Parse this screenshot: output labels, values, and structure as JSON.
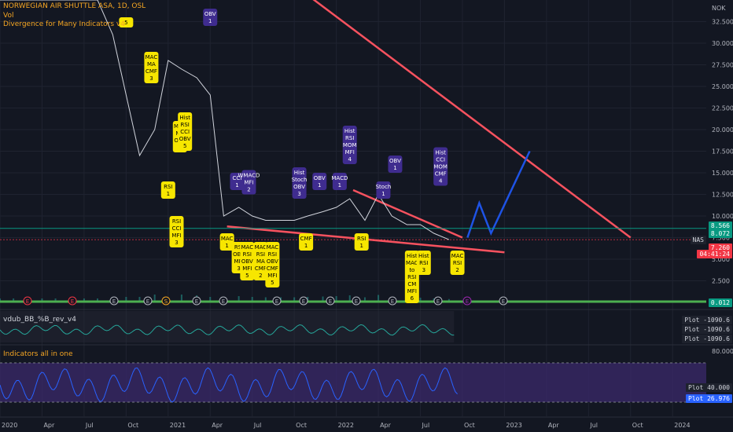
{
  "header": {
    "symbol_line": "NORWEGIAN AIR SHUTTLE ASA, 1D, OSL",
    "vol_label": "Vol",
    "indicator_label": "Divergence for Many Indicators v4",
    "pane2_label": "vdub_BB_%B_rev_v4",
    "pane3_label": "Indicators all in one",
    "currency": "NOK"
  },
  "chart_data": {
    "type": "line",
    "title": "NORWEGIAN AIR SHUTTLE ASA, 1D, OSL",
    "price_axis": {
      "ticks": [
        "32.500",
        "30.000",
        "27.500",
        "25.000",
        "22.500",
        "20.000",
        "17.500",
        "15.000",
        "12.500",
        "10.000",
        "7.500",
        "5.000",
        "2.500"
      ],
      "ylim": [
        0,
        35
      ]
    },
    "x_ticks": [
      "2020",
      "Apr",
      "Jul",
      "Oct",
      "2021",
      "Apr",
      "Jul",
      "Oct",
      "2022",
      "Apr",
      "Jul",
      "Oct",
      "2023",
      "Apr",
      "Jul",
      "Oct",
      "2024"
    ],
    "price_series": {
      "x": [
        2020.0,
        2020.08,
        2020.17,
        2020.25,
        2020.33,
        2020.42,
        2020.5,
        2020.58,
        2020.67,
        2020.75,
        2020.83,
        2020.92,
        2021.0,
        2021.08,
        2021.17,
        2021.25,
        2021.33,
        2021.42,
        2021.5,
        2021.58,
        2021.67,
        2021.75,
        2021.83,
        2021.92,
        2022.0,
        2022.08,
        2022.17,
        2022.25,
        2022.33,
        2022.42,
        2022.5,
        2022.58,
        2022.67
      ],
      "values": [
        36,
        36,
        36,
        36,
        36,
        36,
        36,
        36,
        31,
        24,
        17,
        20,
        28,
        27,
        26,
        24,
        10,
        11,
        10,
        9.5,
        9.5,
        9.5,
        10,
        10.5,
        11,
        12,
        9.5,
        12.5,
        10,
        9,
        9,
        8,
        7.26
      ]
    },
    "price_labels": [
      {
        "text": "8.566",
        "color": "#089981"
      },
      {
        "text": "8.072",
        "color": "#089981"
      },
      {
        "text": "7.260",
        "color": "#f23645"
      },
      {
        "text": "04:41:24",
        "color": "#f23645"
      },
      {
        "text": "0.012",
        "color": "#089981"
      }
    ],
    "nas_label": "NAS",
    "divergence_labels": [
      {
        "x": 2020.75,
        "y": 33,
        "text": [
          "5"
        ],
        "color": "#f7e600"
      },
      {
        "x": 2020.9,
        "y": 29,
        "text": [
          "MAC",
          "MA",
          "CMF",
          "3"
        ],
        "color": "#f7e600"
      },
      {
        "x": 2021.07,
        "y": 21,
        "text": [
          "MAC",
          "MA",
          "ORS",
          "3"
        ],
        "color": "#f7e600"
      },
      {
        "x": 2021.1,
        "y": 22,
        "text": [
          "Hist",
          "RSI",
          "CCI",
          "OBV",
          "5"
        ],
        "color": "#f7e600"
      },
      {
        "x": 2021.0,
        "y": 14,
        "text": [
          "RSI",
          "1"
        ],
        "color": "#f7e600"
      },
      {
        "x": 2021.05,
        "y": 10,
        "text": [
          "RSI",
          "CCI",
          "MFI",
          "3"
        ],
        "color": "#f7e600"
      },
      {
        "x": 2021.35,
        "y": 8,
        "text": [
          "MAC",
          "1"
        ],
        "color": "#f7e600"
      },
      {
        "x": 2021.42,
        "y": 7,
        "text": [
          "RSI",
          "OBV",
          "MFI",
          "3"
        ],
        "color": "#f7e600"
      },
      {
        "x": 2021.47,
        "y": 7,
        "text": [
          "MAC",
          "RSI",
          "OBV",
          "MFI",
          "5"
        ],
        "color": "#f7e600"
      },
      {
        "x": 2021.55,
        "y": 7,
        "text": [
          "MAC",
          "RSI",
          "MA",
          "CMF",
          "2"
        ],
        "color": "#f7e600"
      },
      {
        "x": 2021.62,
        "y": 7,
        "text": [
          "MAC",
          "RSI",
          "OBV",
          "CMF",
          "MFI",
          "5"
        ],
        "color": "#f7e600"
      },
      {
        "x": 2021.82,
        "y": 8,
        "text": [
          "CMF",
          "1"
        ],
        "color": "#f7e600"
      },
      {
        "x": 2022.15,
        "y": 8,
        "text": [
          "RSI",
          "1"
        ],
        "color": "#f7e600"
      },
      {
        "x": 2022.45,
        "y": 6,
        "text": [
          "Hist",
          "MAC",
          "to",
          "RSI",
          "CM",
          "MFI",
          "6"
        ],
        "color": "#f7e600"
      },
      {
        "x": 2022.52,
        "y": 6,
        "text": [
          "Hist",
          "RSI",
          "3"
        ],
        "color": "#f7e600"
      },
      {
        "x": 2022.72,
        "y": 6,
        "text": [
          "MAC",
          "RSI",
          "2"
        ],
        "color": "#f7e600"
      },
      {
        "x": 2021.25,
        "y": 32,
        "text": [
          "OBV",
          "1"
        ],
        "color": "#3f2c8f"
      },
      {
        "x": 2021.41,
        "y": 13,
        "text": [
          "CCI",
          "1"
        ],
        "color": "#3f2c8f"
      },
      {
        "x": 2021.48,
        "y": 12.5,
        "text": [
          "WMACD",
          "MFI",
          "2"
        ],
        "color": "#3f2c8f"
      },
      {
        "x": 2021.78,
        "y": 12,
        "text": [
          "Hist",
          "Stoch",
          "OBV",
          "3"
        ],
        "color": "#3f2c8f"
      },
      {
        "x": 2021.9,
        "y": 13,
        "text": [
          "OBV",
          "1"
        ],
        "color": "#3f2c8f"
      },
      {
        "x": 2022.02,
        "y": 13,
        "text": [
          "MACD",
          "1"
        ],
        "color": "#3f2c8f"
      },
      {
        "x": 2022.08,
        "y": 16,
        "text": [
          "Hist",
          "RSI",
          "MOM",
          "MFI",
          "4"
        ],
        "color": "#3f2c8f"
      },
      {
        "x": 2022.28,
        "y": 12,
        "text": [
          "Stoch",
          "1"
        ],
        "color": "#3f2c8f"
      },
      {
        "x": 2022.35,
        "y": 15,
        "text": [
          "OBV",
          "1"
        ],
        "color": "#3f2c8f"
      },
      {
        "x": 2022.62,
        "y": 13.5,
        "text": [
          "Hist",
          "CCI",
          "MOM",
          "CMF",
          "4"
        ],
        "color": "#3f2c8f"
      }
    ],
    "event_markers": [
      "E",
      "E",
      "E",
      "E",
      "S",
      "E",
      "E",
      "E",
      "E",
      "E",
      "E",
      "E",
      "E",
      "E",
      "E"
    ],
    "pane2": {
      "name": "vdub_BB_%B_rev_v4",
      "plot_labels": [
        {
          "name": "Plot",
          "value": "-1090.6"
        },
        {
          "name": "Plot",
          "value": "-1090.6"
        },
        {
          "name": "Plot",
          "value": "-1090.6"
        }
      ]
    },
    "pane3": {
      "name": "Indicators all in one",
      "ticks": [
        "80.000",
        "40.000",
        "26.976"
      ],
      "plot_labels": [
        {
          "name": "Plot",
          "value": "40.000"
        },
        {
          "name": "Plot",
          "value": "26.976"
        }
      ]
    }
  }
}
